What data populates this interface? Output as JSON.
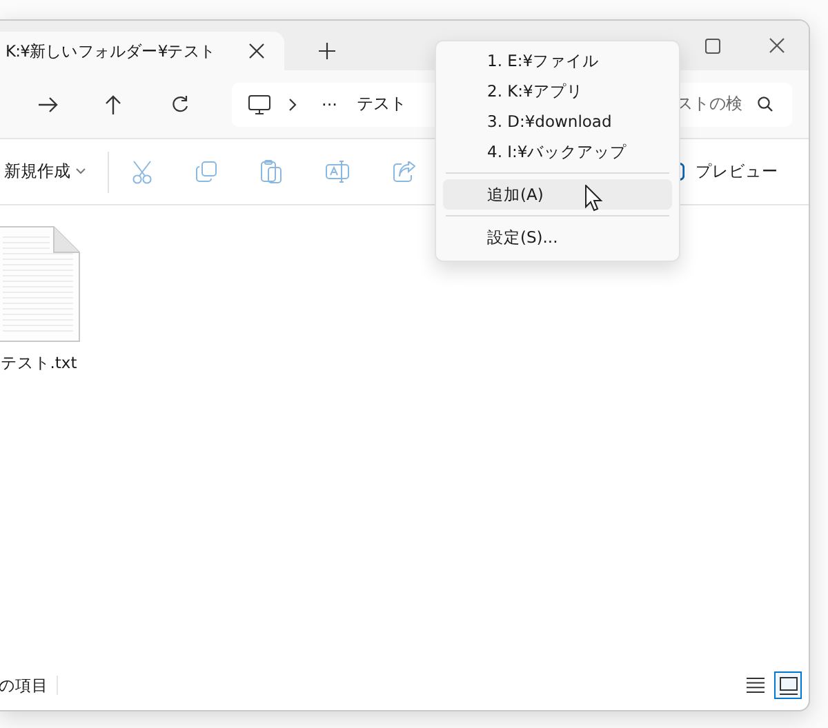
{
  "window": {
    "tab_title": "K:¥新しいフォルダー¥テスト"
  },
  "address_bar": {
    "ellipsis": "···",
    "folder": "テスト"
  },
  "search": {
    "placeholder": "ストの検"
  },
  "toolbar": {
    "new_button": "新規作成",
    "actions": [
      {
        "disabled": true
      },
      {
        "disabled": true
      },
      {
        "disabled": true
      },
      {
        "disabled": true
      },
      {
        "disabled": true
      }
    ],
    "preview_button": "プレビュー"
  },
  "files": [
    {
      "name": "テスト.txt"
    }
  ],
  "status_bar": {
    "text": "の項目",
    "views": [
      {
        "selected": false
      },
      {
        "selected": true
      }
    ]
  },
  "menu": {
    "groups": [
      [
        {
          "label": "1. E:¥ファイル",
          "selected": false
        },
        {
          "label": "2. K:¥アプリ",
          "selected": false
        },
        {
          "label": "3. D:¥download",
          "selected": false
        },
        {
          "label": "4. I:¥バックアップ",
          "selected": false
        }
      ],
      [
        {
          "label": "追加(A)",
          "selected": true
        }
      ],
      [
        {
          "label": "設定(S)...",
          "selected": false
        }
      ]
    ]
  }
}
